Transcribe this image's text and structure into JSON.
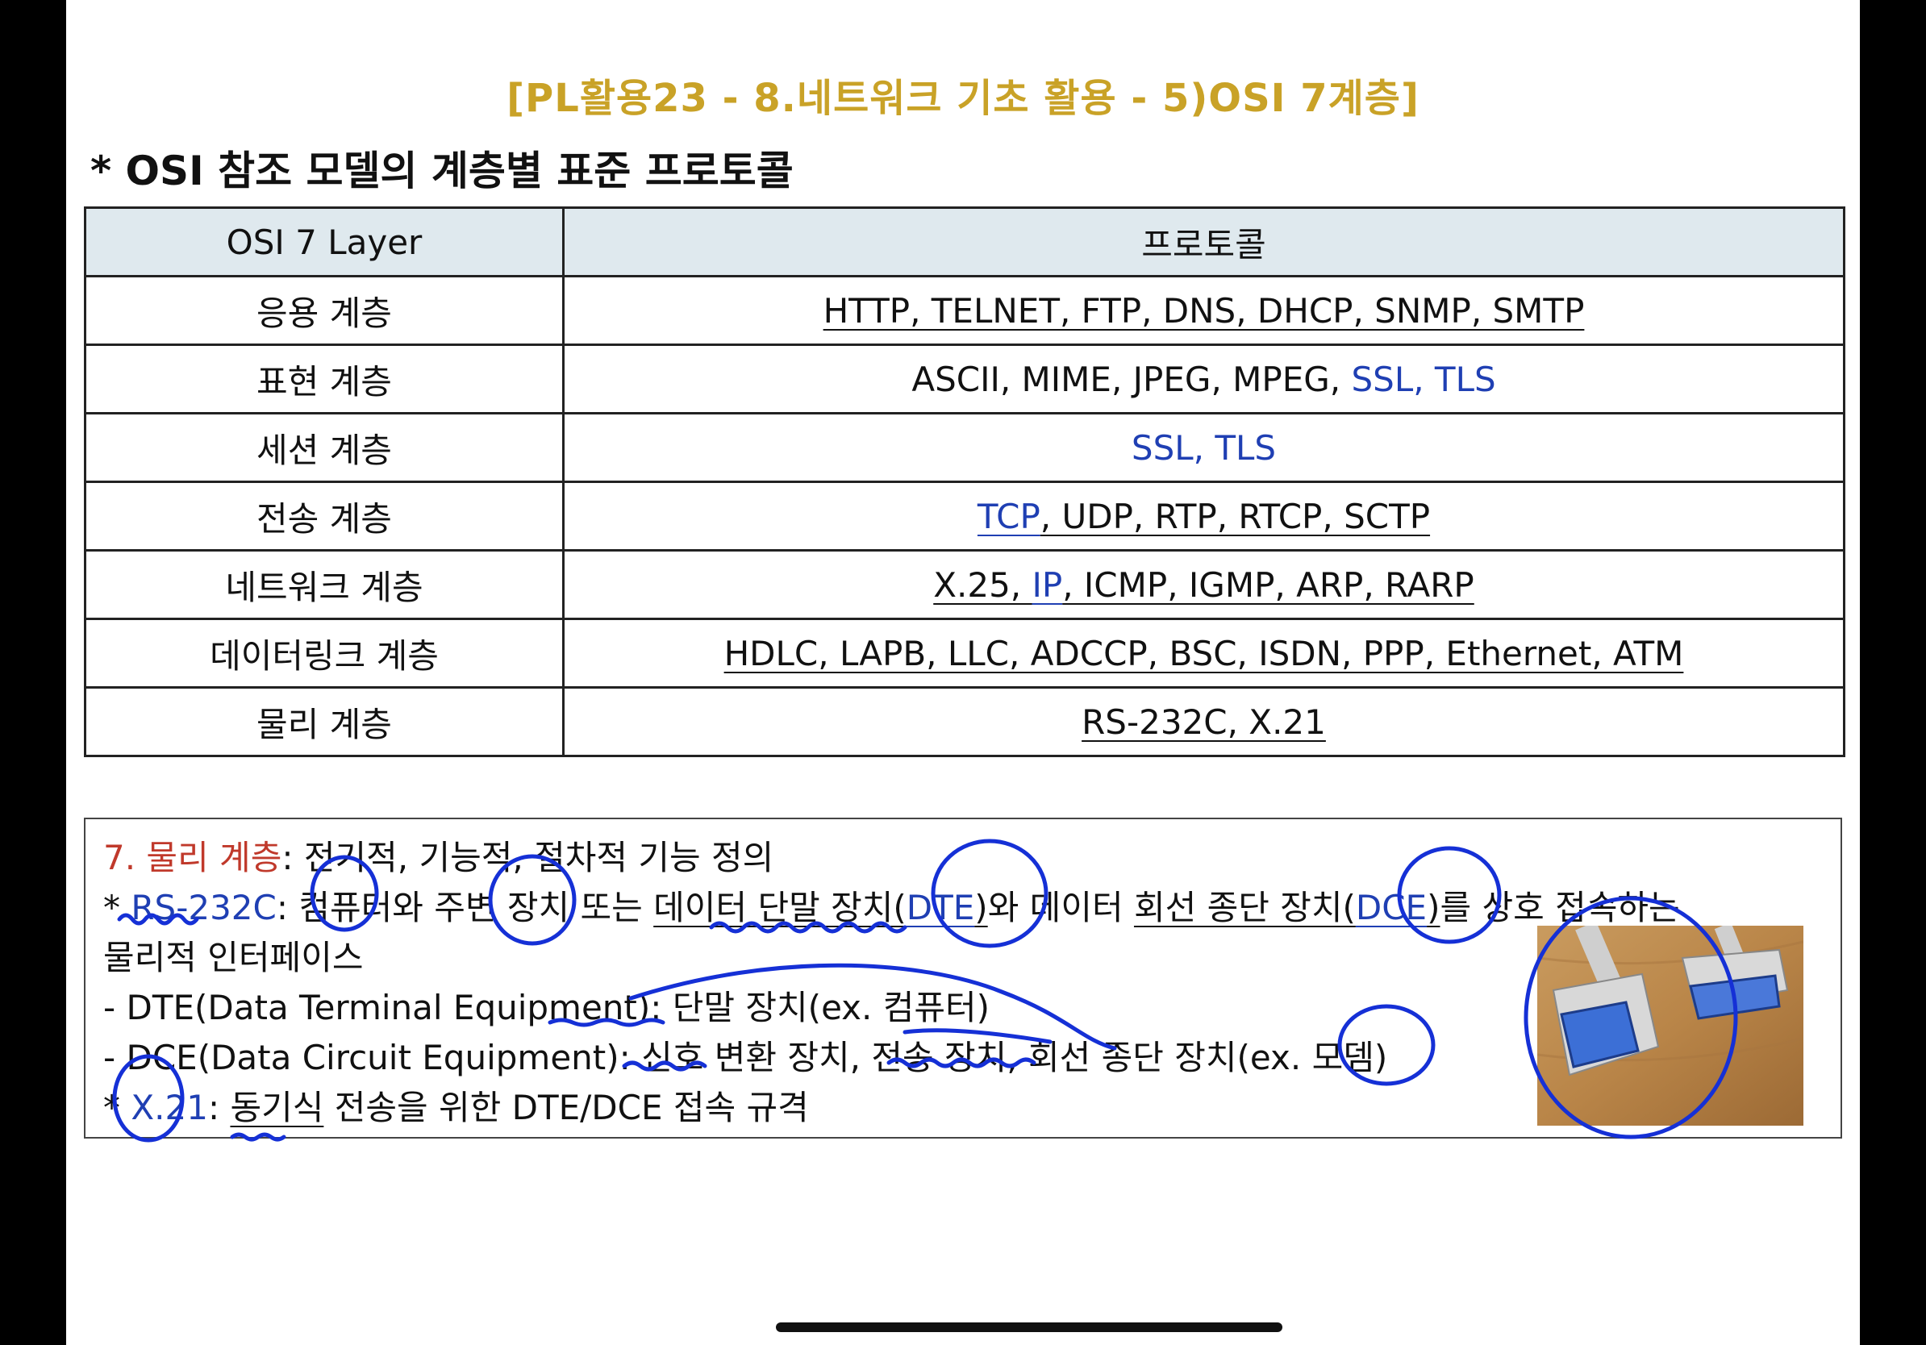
{
  "slide_title": "[PL활용23 - 8.네트워크 기초 활용 - 5)OSI 7계층]",
  "section_heading": "* OSI 참조 모델의 계층별 표준 프로토콜",
  "table": {
    "headers": [
      "OSI 7 Layer",
      "프로토콜"
    ],
    "rows": [
      {
        "layer": "응용 계층",
        "protocols": "HTTP, TELNET, FTP, DNS, DHCP, SNMP, SMTP"
      },
      {
        "layer": "표현 계층",
        "protocols_black": "ASCII, MIME, JPEG, MPEG, ",
        "protocols_blue": "SSL, TLS"
      },
      {
        "layer": "세션 계층",
        "protocols_blue": "SSL, TLS"
      },
      {
        "layer": "전송 계층",
        "tcp": "TCP",
        "rest": ", UDP, RTP, RTCP, SCTP"
      },
      {
        "layer": "네트워크 계층",
        "x25": "X.25, ",
        "ip": "IP",
        "rest": ", ICMP, IGMP, ARP, RARP"
      },
      {
        "layer": "데이터링크 계층",
        "protocols": "HDLC, LAPB, LLC, ADCCP, BSC, ISDN, PPP, Ethernet, ATM"
      },
      {
        "layer": "물리 계층",
        "protocols": "RS-232C, X.21"
      }
    ]
  },
  "notes": {
    "line1_label": "7. 물리 계층",
    "line1_text": ": 전기적, 기능적, 절차적 기능 정의",
    "line2_star": "* ",
    "line2_term": "RS-232C",
    "line2_a": ": 컴퓨터와 주변 장치 또는 ",
    "line2_b": "데이터 단말 장치(",
    "line2_dte": "DTE",
    "line2_c": ")",
    "line2_d": "와 데이터 ",
    "line2_e": "회선 종단 장치(",
    "line2_dce": "DCE",
    "line2_f": ")",
    "line2_g": "를 상호 접속하는",
    "line3": "물리적 인터페이스",
    "line4": "- DTE(Data Terminal Equipment): 단말 장치(ex. 컴퓨터)",
    "line5": "- DCE(Data Circuit Equipment): 신호 변환 장치, 전송 장치, 회선 종단 장치(ex. 모뎀)",
    "line6_star": "* ",
    "line6_term": "X.21",
    "line6_colon": ": ",
    "line6_sync": "동기식",
    "line6_rest": " 전송을 위한 DTE/DCE 접속 규격"
  },
  "colors": {
    "title": "#c9a227",
    "accent_blue": "#1f3fb3",
    "accent_red": "#c0392b",
    "ink": "#1530d6",
    "header_bg": "#dfe9ee"
  }
}
